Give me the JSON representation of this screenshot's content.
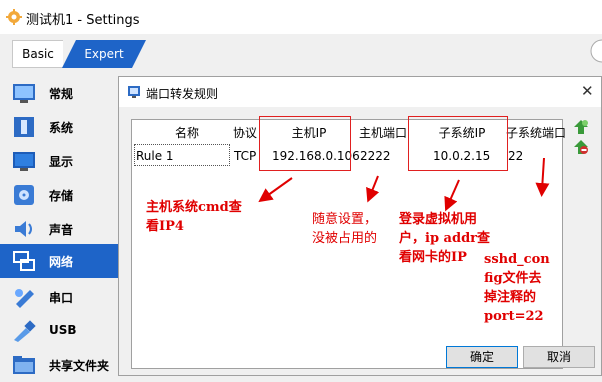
{
  "window": {
    "title": "测试机1 - Settings"
  },
  "mode_tabs": {
    "basic": "Basic",
    "expert": "Expert"
  },
  "sidebar": {
    "items": [
      {
        "label": "常规",
        "icon": "general-icon"
      },
      {
        "label": "系统",
        "icon": "system-icon"
      },
      {
        "label": "显示",
        "icon": "display-icon"
      },
      {
        "label": "存储",
        "icon": "storage-icon"
      },
      {
        "label": "声音",
        "icon": "audio-icon"
      },
      {
        "label": "网络",
        "icon": "network-icon",
        "active": true
      },
      {
        "label": "串口",
        "icon": "serial-port-icon"
      },
      {
        "label": "USB",
        "icon": "usb-icon"
      },
      {
        "label": "共享文件夹",
        "icon": "shared-folder-icon"
      }
    ]
  },
  "dialog": {
    "title": "端口转发规则",
    "close": "✕",
    "columns": [
      "名称",
      "协议",
      "主机IP",
      "主机端口",
      "子系统IP",
      "子系统端口"
    ],
    "rows": [
      {
        "name": "Rule 1",
        "protocol": "TCP",
        "host_ip": "192.168.0.106",
        "host_port": "2222",
        "guest_ip": "10.0.2.15",
        "guest_port": "22"
      }
    ],
    "ok": "确定",
    "cancel": "取消"
  },
  "annotations": {
    "note1_line1": "主机系统cmd查",
    "note1_line2": "看IP4",
    "note2_line1": "随意设置，",
    "note2_line2": "没被占用的",
    "note3_line1": "登录虚拟机用",
    "note3_line2": "户，ip addr查",
    "note3_line3": "看网卡的IP",
    "note4_line1": "sshd_con",
    "note4_line2": "fig文件去",
    "note4_line3": "掉注释的",
    "note4_line4": "port=22",
    "color": "#e00000"
  }
}
